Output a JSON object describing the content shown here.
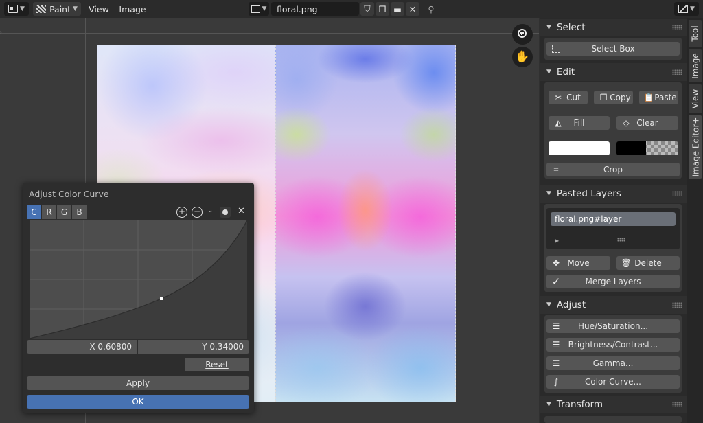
{
  "header": {
    "mode": "Paint",
    "menu": [
      "View",
      "Image"
    ],
    "filename": "floral.png"
  },
  "dialog": {
    "title": "Adjust Color Curve",
    "channels": [
      "C",
      "R",
      "G",
      "B"
    ],
    "active_channel": "C",
    "x_value": "X 0.60800",
    "y_value": "Y 0.34000",
    "reset": "Reset",
    "apply": "Apply",
    "ok": "OK"
  },
  "sidebar": {
    "select": {
      "title": "Select",
      "select_box": "Select Box"
    },
    "edit": {
      "title": "Edit",
      "cut": "Cut",
      "copy": "Copy",
      "paste": "Paste",
      "fill": "Fill",
      "clear": "Clear",
      "crop": "Crop"
    },
    "pasted_layers": {
      "title": "Pasted Layers",
      "layer": "floral.png#layer",
      "move": "Move",
      "delete": "Delete",
      "merge": "Merge Layers"
    },
    "adjust": {
      "title": "Adjust",
      "hue": "Hue/Saturation...",
      "brightness": "Brightness/Contrast...",
      "gamma": "Gamma...",
      "curve": "Color Curve..."
    },
    "transform": {
      "title": "Transform"
    }
  },
  "vtabs": [
    "Tool",
    "Image",
    "View",
    "Image Editor+"
  ],
  "colors": {
    "accent": "#4772b3",
    "primary": "#ffffff",
    "secondary": "#000000"
  }
}
